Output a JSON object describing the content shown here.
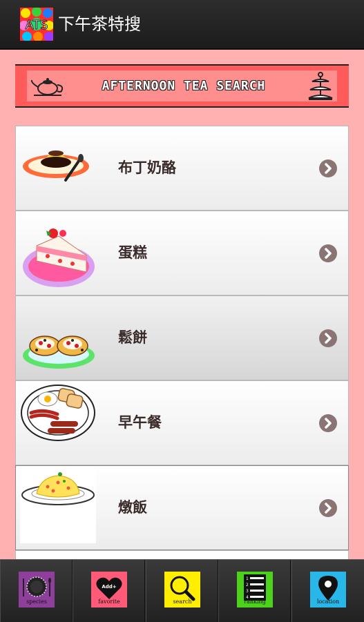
{
  "app": {
    "icon_text": "ATS",
    "title": "下午茶特搜"
  },
  "banner": {
    "text": "AFTERNOON TEA SEARCH",
    "left_icon": "teapot-icon",
    "right_icon": "cake-stand-icon"
  },
  "categories": [
    {
      "label": "布丁奶酪",
      "icon": "pudding-icon",
      "selected": false
    },
    {
      "label": "蛋糕",
      "icon": "cake-icon",
      "selected": false
    },
    {
      "label": "鬆餅",
      "icon": "scone-icon",
      "selected": true
    },
    {
      "label": "早午餐",
      "icon": "brunch-icon",
      "selected": false
    },
    {
      "label": "燉飯",
      "icon": "risotto-icon",
      "selected": false
    }
  ],
  "bottom_nav": [
    {
      "label": "species",
      "icon": "plate-cutlery-icon",
      "color": "#8e3f9b"
    },
    {
      "label": "favorite",
      "icon_text": "Add+",
      "icon": "heart-icon",
      "color": "#ff5a78"
    },
    {
      "label": "search",
      "icon": "magnifier-icon",
      "color": "#ffee00"
    },
    {
      "label": "ranking",
      "icon_text": [
        "1",
        "2",
        "3",
        "4"
      ],
      "icon": "list-icon",
      "color": "#4cd21a"
    },
    {
      "label": "location",
      "icon": "map-pin-icon",
      "color": "#29b6e8"
    }
  ],
  "colors": {
    "background": "#ffb1b1",
    "banner": "#ff5b5b",
    "actionbar": "#222222",
    "chevron": "#8a7474"
  }
}
